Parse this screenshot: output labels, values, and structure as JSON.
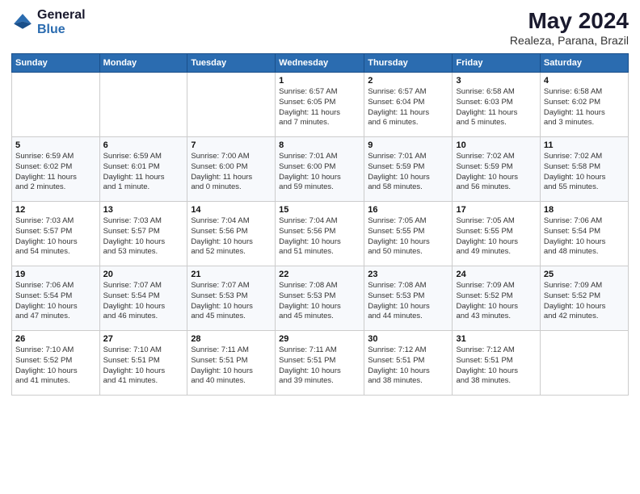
{
  "logo": {
    "line1": "General",
    "line2": "Blue"
  },
  "title": "May 2024",
  "subtitle": "Realeza, Parana, Brazil",
  "days_of_week": [
    "Sunday",
    "Monday",
    "Tuesday",
    "Wednesday",
    "Thursday",
    "Friday",
    "Saturday"
  ],
  "weeks": [
    [
      {
        "day": "",
        "info": ""
      },
      {
        "day": "",
        "info": ""
      },
      {
        "day": "",
        "info": ""
      },
      {
        "day": "1",
        "info": "Sunrise: 6:57 AM\nSunset: 6:05 PM\nDaylight: 11 hours\nand 7 minutes."
      },
      {
        "day": "2",
        "info": "Sunrise: 6:57 AM\nSunset: 6:04 PM\nDaylight: 11 hours\nand 6 minutes."
      },
      {
        "day": "3",
        "info": "Sunrise: 6:58 AM\nSunset: 6:03 PM\nDaylight: 11 hours\nand 5 minutes."
      },
      {
        "day": "4",
        "info": "Sunrise: 6:58 AM\nSunset: 6:02 PM\nDaylight: 11 hours\nand 3 minutes."
      }
    ],
    [
      {
        "day": "5",
        "info": "Sunrise: 6:59 AM\nSunset: 6:02 PM\nDaylight: 11 hours\nand 2 minutes."
      },
      {
        "day": "6",
        "info": "Sunrise: 6:59 AM\nSunset: 6:01 PM\nDaylight: 11 hours\nand 1 minute."
      },
      {
        "day": "7",
        "info": "Sunrise: 7:00 AM\nSunset: 6:00 PM\nDaylight: 11 hours\nand 0 minutes."
      },
      {
        "day": "8",
        "info": "Sunrise: 7:01 AM\nSunset: 6:00 PM\nDaylight: 10 hours\nand 59 minutes."
      },
      {
        "day": "9",
        "info": "Sunrise: 7:01 AM\nSunset: 5:59 PM\nDaylight: 10 hours\nand 58 minutes."
      },
      {
        "day": "10",
        "info": "Sunrise: 7:02 AM\nSunset: 5:59 PM\nDaylight: 10 hours\nand 56 minutes."
      },
      {
        "day": "11",
        "info": "Sunrise: 7:02 AM\nSunset: 5:58 PM\nDaylight: 10 hours\nand 55 minutes."
      }
    ],
    [
      {
        "day": "12",
        "info": "Sunrise: 7:03 AM\nSunset: 5:57 PM\nDaylight: 10 hours\nand 54 minutes."
      },
      {
        "day": "13",
        "info": "Sunrise: 7:03 AM\nSunset: 5:57 PM\nDaylight: 10 hours\nand 53 minutes."
      },
      {
        "day": "14",
        "info": "Sunrise: 7:04 AM\nSunset: 5:56 PM\nDaylight: 10 hours\nand 52 minutes."
      },
      {
        "day": "15",
        "info": "Sunrise: 7:04 AM\nSunset: 5:56 PM\nDaylight: 10 hours\nand 51 minutes."
      },
      {
        "day": "16",
        "info": "Sunrise: 7:05 AM\nSunset: 5:55 PM\nDaylight: 10 hours\nand 50 minutes."
      },
      {
        "day": "17",
        "info": "Sunrise: 7:05 AM\nSunset: 5:55 PM\nDaylight: 10 hours\nand 49 minutes."
      },
      {
        "day": "18",
        "info": "Sunrise: 7:06 AM\nSunset: 5:54 PM\nDaylight: 10 hours\nand 48 minutes."
      }
    ],
    [
      {
        "day": "19",
        "info": "Sunrise: 7:06 AM\nSunset: 5:54 PM\nDaylight: 10 hours\nand 47 minutes."
      },
      {
        "day": "20",
        "info": "Sunrise: 7:07 AM\nSunset: 5:54 PM\nDaylight: 10 hours\nand 46 minutes."
      },
      {
        "day": "21",
        "info": "Sunrise: 7:07 AM\nSunset: 5:53 PM\nDaylight: 10 hours\nand 45 minutes."
      },
      {
        "day": "22",
        "info": "Sunrise: 7:08 AM\nSunset: 5:53 PM\nDaylight: 10 hours\nand 45 minutes."
      },
      {
        "day": "23",
        "info": "Sunrise: 7:08 AM\nSunset: 5:53 PM\nDaylight: 10 hours\nand 44 minutes."
      },
      {
        "day": "24",
        "info": "Sunrise: 7:09 AM\nSunset: 5:52 PM\nDaylight: 10 hours\nand 43 minutes."
      },
      {
        "day": "25",
        "info": "Sunrise: 7:09 AM\nSunset: 5:52 PM\nDaylight: 10 hours\nand 42 minutes."
      }
    ],
    [
      {
        "day": "26",
        "info": "Sunrise: 7:10 AM\nSunset: 5:52 PM\nDaylight: 10 hours\nand 41 minutes."
      },
      {
        "day": "27",
        "info": "Sunrise: 7:10 AM\nSunset: 5:51 PM\nDaylight: 10 hours\nand 41 minutes."
      },
      {
        "day": "28",
        "info": "Sunrise: 7:11 AM\nSunset: 5:51 PM\nDaylight: 10 hours\nand 40 minutes."
      },
      {
        "day": "29",
        "info": "Sunrise: 7:11 AM\nSunset: 5:51 PM\nDaylight: 10 hours\nand 39 minutes."
      },
      {
        "day": "30",
        "info": "Sunrise: 7:12 AM\nSunset: 5:51 PM\nDaylight: 10 hours\nand 38 minutes."
      },
      {
        "day": "31",
        "info": "Sunrise: 7:12 AM\nSunset: 5:51 PM\nDaylight: 10 hours\nand 38 minutes."
      },
      {
        "day": "",
        "info": ""
      }
    ]
  ]
}
